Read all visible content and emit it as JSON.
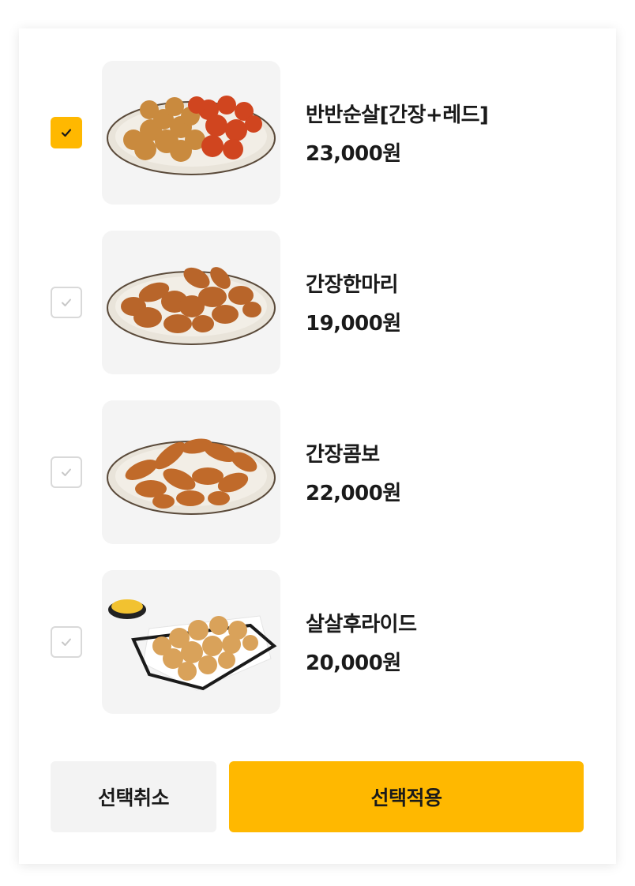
{
  "accent_color": "#FFB800",
  "items": [
    {
      "name": "반반순살[간장+레드]",
      "price": "23,000원",
      "checked": true,
      "image": "half-half-boneless-chicken-plate"
    },
    {
      "name": "간장한마리",
      "price": "19,000원",
      "checked": false,
      "image": "soy-whole-chicken-plate"
    },
    {
      "name": "간장콤보",
      "price": "22,000원",
      "checked": false,
      "image": "soy-combo-chicken-plate"
    },
    {
      "name": "살살후라이드",
      "price": "20,000원",
      "checked": false,
      "image": "fried-chicken-basket-with-sauce"
    }
  ],
  "actions": {
    "cancel_label": "선택취소",
    "apply_label": "선택적용"
  }
}
